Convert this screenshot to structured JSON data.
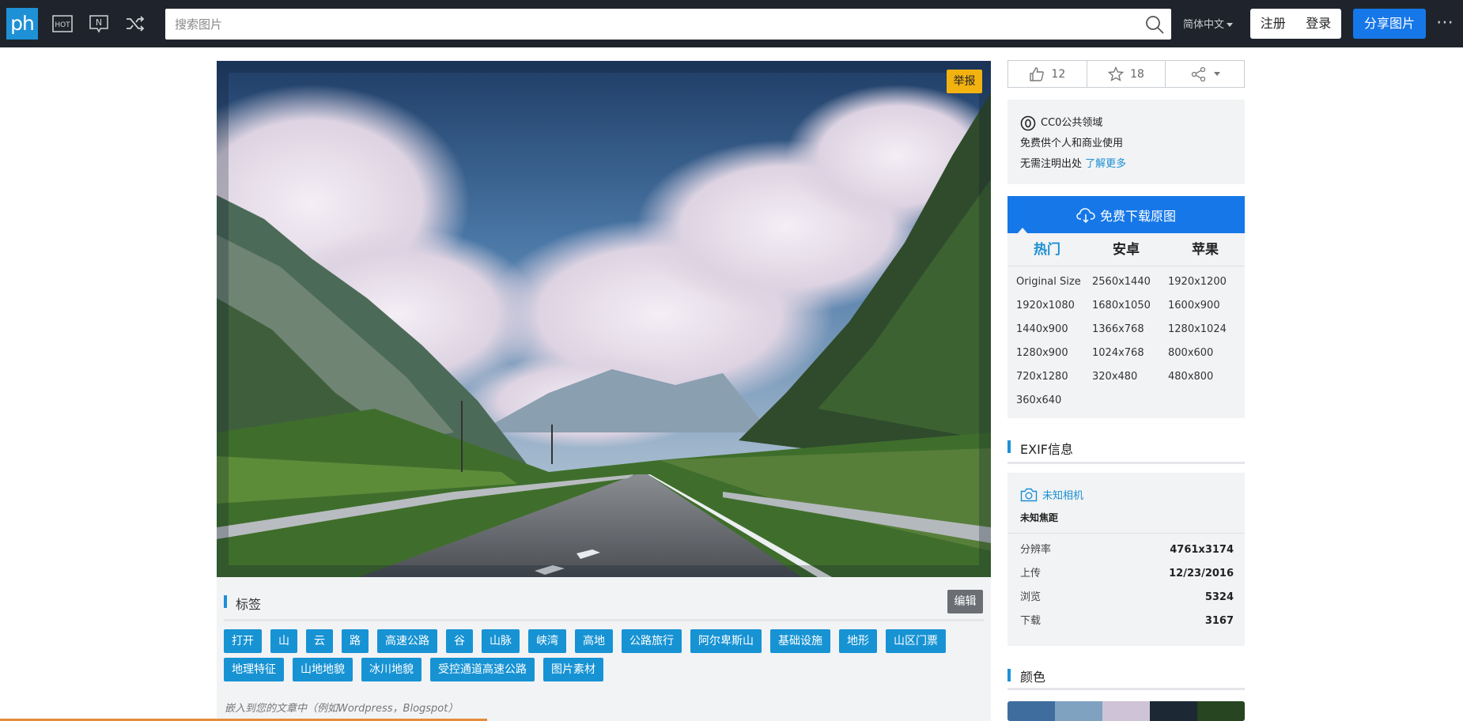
{
  "topbar": {
    "logo_text": "ph",
    "search_placeholder": "搜索图片",
    "language": "简体中文",
    "register": "注册",
    "login": "登录",
    "share": "分享图片",
    "more": "⋯"
  },
  "photo": {
    "report": "举报"
  },
  "tags": {
    "title": "标签",
    "edit": "编辑",
    "items": [
      "打开",
      "山",
      "云",
      "路",
      "高速公路",
      "谷",
      "山脉",
      "峡湾",
      "高地",
      "公路旅行",
      "阿尔卑斯山",
      "基础设施",
      "地形",
      "山区门票",
      "地理特征",
      "山地地貌",
      "冰川地貌",
      "受控通道高速公路",
      "图片素材"
    ],
    "embed": "嵌入到您的文章中（例如Wordpress，Blogspot）"
  },
  "actions": {
    "likes": "12",
    "favorites": "18"
  },
  "license": {
    "name": "CC0公共领域",
    "line1": "免费供个人和商业使用",
    "line2": "无需注明出处",
    "learn_more": "了解更多"
  },
  "download": {
    "label": "免费下载原图",
    "tabs": [
      "热门",
      "安卓",
      "苹果"
    ],
    "active_tab": "热门",
    "sizes": [
      "Original Size",
      "2560x1440",
      "1920x1200",
      "1920x1080",
      "1680x1050",
      "1600x900",
      "1440x900",
      "1366x768",
      "1280x1024",
      "1280x900",
      "1024x768",
      "800x600",
      "720x1280",
      "320x480",
      "480x800",
      "360x640"
    ]
  },
  "exif": {
    "title": "EXIF信息",
    "camera": "未知相机",
    "focal": "未知焦距",
    "rows": [
      {
        "k": "分辨率",
        "v": "4761x3174"
      },
      {
        "k": "上传",
        "v": "12/23/2016"
      },
      {
        "k": "浏览",
        "v": "5324"
      },
      {
        "k": "下载",
        "v": "3167"
      }
    ]
  },
  "colors": {
    "title": "颜色",
    "swatches": [
      "#3f6e9e",
      "#7fa2c0",
      "#cfc3d8",
      "#1c2935",
      "#264520"
    ]
  },
  "icons": {
    "hot": "hot-icon",
    "new": "new-icon",
    "random": "shuffle-icon",
    "search": "search-icon",
    "like": "thumbs-up-icon",
    "favorite": "star-icon",
    "share": "share-icon",
    "cc0": "cc0-icon",
    "cloud": "cloud-download-icon",
    "camera": "camera-icon"
  },
  "accent_colors": {
    "topbar": "#1f242c",
    "logo": "#1e90d6",
    "primary": "#1677e8",
    "tag": "#1793d4",
    "report": "#f2b311"
  }
}
